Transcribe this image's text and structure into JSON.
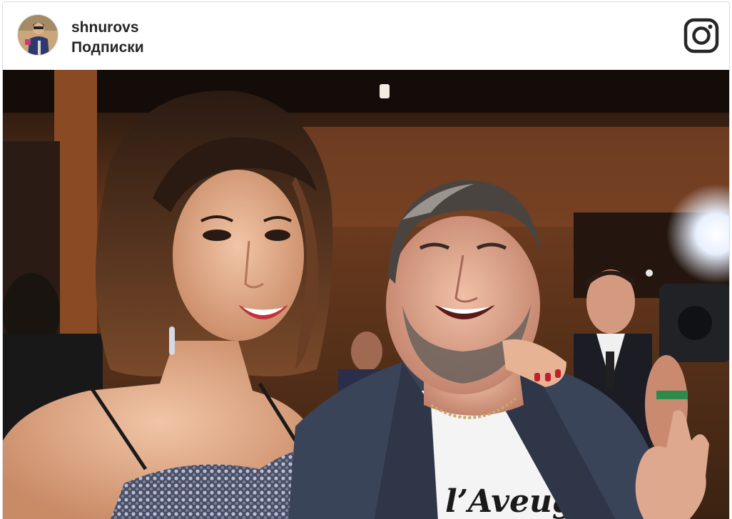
{
  "post": {
    "username": "shnurovs",
    "follow_label": "Подписки",
    "avatar_icon": "user-avatar",
    "brand_icon": "instagram-icon"
  },
  "photo": {
    "shirt_text": "l’Aveugle"
  },
  "colors": {
    "header_bg": "#ffffff",
    "text": "#262626",
    "border": "#dbdbdb"
  }
}
